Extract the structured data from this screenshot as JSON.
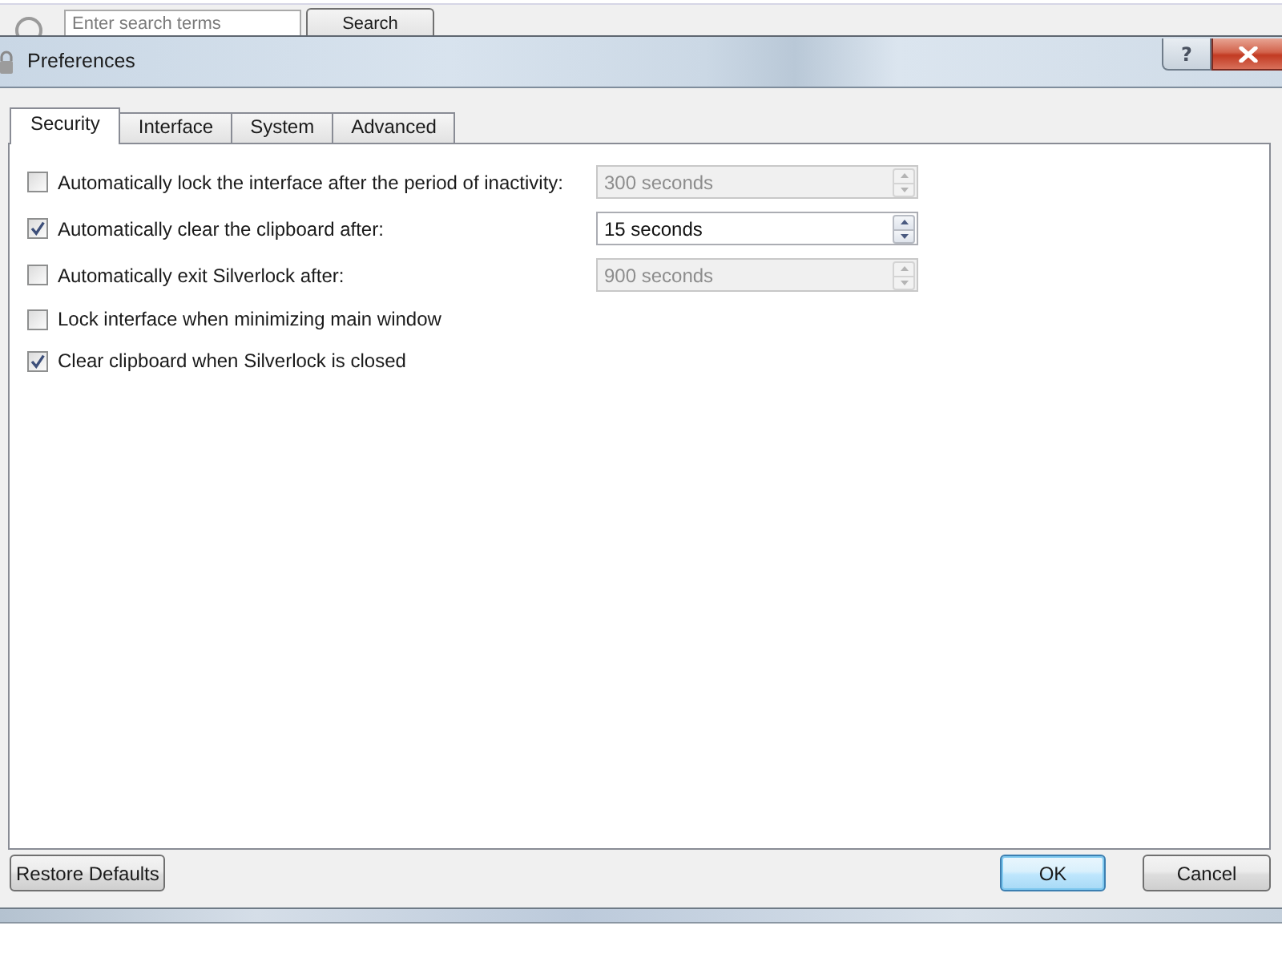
{
  "background_window": {
    "search_field": {
      "placeholder": "Enter search terms"
    },
    "search_button": "Search"
  },
  "title_bar": {
    "title": "Preferences",
    "help_button": "?"
  },
  "tabs": [
    {
      "label": "Security",
      "selected": true
    },
    {
      "label": "Interface",
      "selected": false
    },
    {
      "label": "System",
      "selected": false
    },
    {
      "label": "Advanced",
      "selected": false
    }
  ],
  "options": [
    {
      "kind": "spin",
      "label": "Automatically lock the interface after the period of inactivity:",
      "checked": false,
      "field": {
        "value": "300 seconds",
        "disabled": true
      }
    },
    {
      "kind": "spin",
      "label": "Automatically clear the clipboard after:",
      "checked": true,
      "field": {
        "value": "15 seconds",
        "disabled": false
      }
    },
    {
      "kind": "spin",
      "label": "Automatically exit Silverlock after:",
      "checked": false,
      "field": {
        "value": "900 seconds",
        "disabled": true
      }
    },
    {
      "kind": "check",
      "label": "Lock interface when minimizing main window",
      "checked": false
    },
    {
      "kind": "check",
      "label": "Clear clipboard when Silverlock is closed",
      "checked": true
    }
  ],
  "footer": {
    "left_buttons": [
      {
        "label": "Restore Defaults",
        "focused": false
      }
    ],
    "right_buttons": [
      {
        "label": "OK",
        "focused": true
      },
      {
        "label": "Cancel",
        "focused": false
      }
    ]
  }
}
